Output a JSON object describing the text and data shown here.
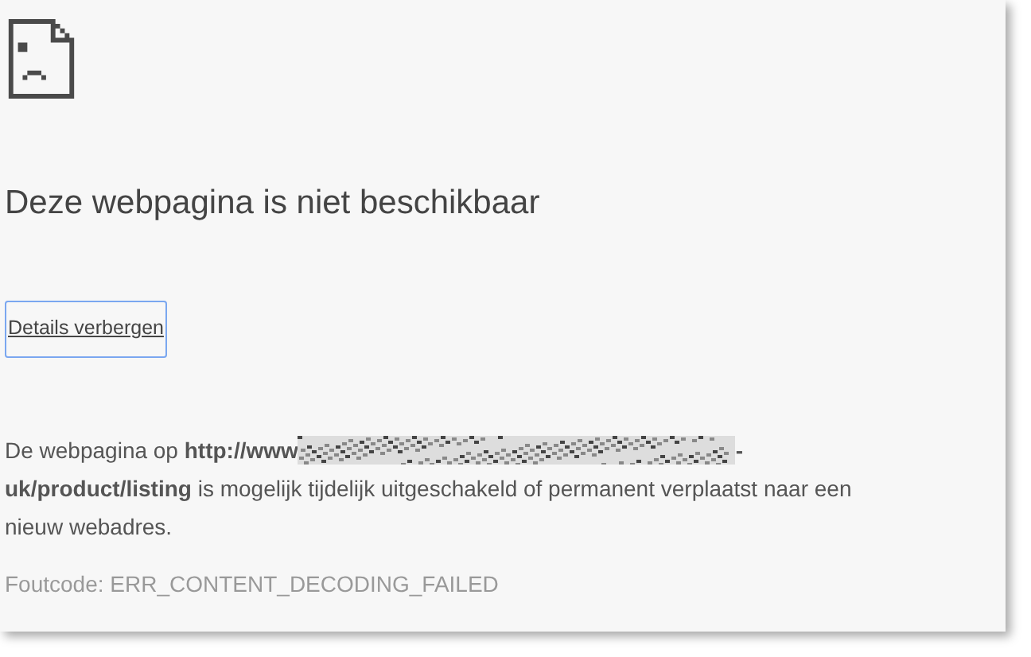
{
  "heading": "Deze webpagina is niet beschikbaar",
  "details_button": "Details verbergen",
  "message_start": "De webpagina op **http://www**",
  "message_hyphen": "-",
  "message_end": "**uk/product/listing** is mogelijk tijdelijk uitgeschakeld of permanent verplaatst naar een nieuw webadres.",
  "error_code": "Foutcode: ERR_CONTENT_DECODING_FAILED"
}
